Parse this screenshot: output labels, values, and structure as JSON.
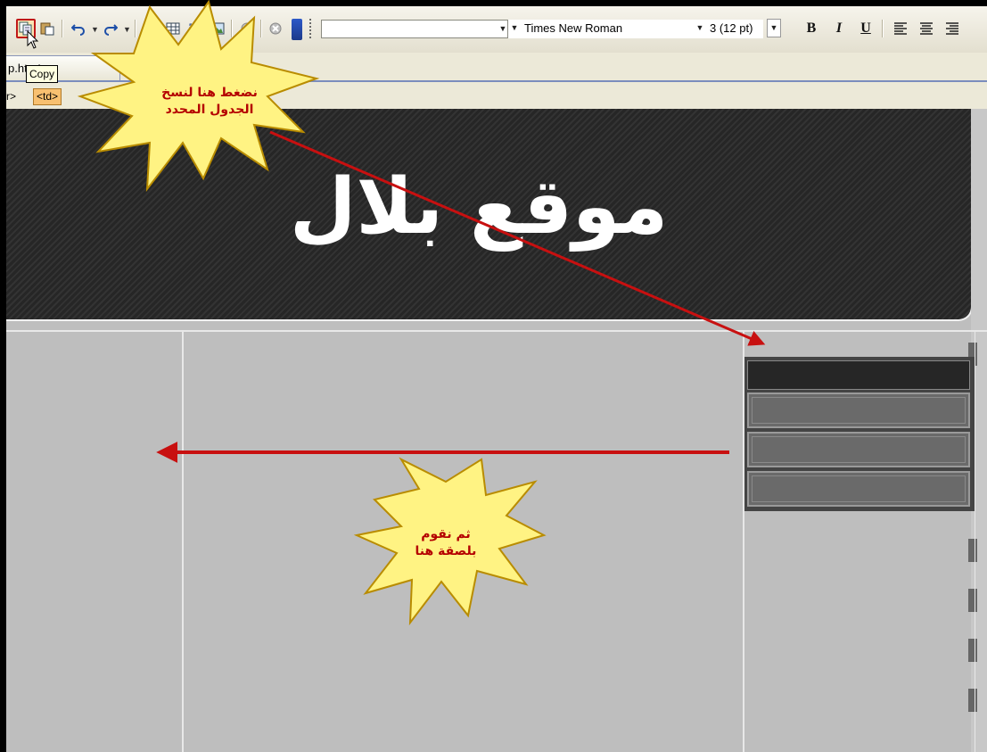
{
  "toolbar": {
    "buttons": [
      {
        "name": "copy-button",
        "icon": "copy-icon"
      },
      {
        "name": "paste-button",
        "icon": "paste-icon"
      },
      {
        "name": "undo-button",
        "icon": "undo-icon"
      },
      {
        "name": "redo-button",
        "icon": "redo-icon"
      },
      {
        "name": "insert-button",
        "icon": "insert-icon"
      },
      {
        "name": "table-button",
        "icon": "table-icon"
      },
      {
        "name": "layer-button",
        "icon": "layer-icon"
      },
      {
        "name": "image-button",
        "icon": "image-icon"
      },
      {
        "name": "link-button",
        "icon": "link-icon"
      },
      {
        "name": "stop-button",
        "icon": "stop-icon"
      }
    ],
    "style_value": "",
    "font_value": "Times New Roman",
    "size_value": "3 (12 pt)",
    "bold_label": "B",
    "italic_label": "I",
    "underline_label": "U",
    "align_icons": [
      "align-left-icon",
      "align-center-icon",
      "align-right-icon"
    ]
  },
  "tooltip": {
    "text": "Copy"
  },
  "tab": {
    "label": "p.htm*"
  },
  "tag_selector": {
    "tags": [
      "r>",
      "<td>"
    ]
  },
  "design": {
    "logo_text": "موقع بلال",
    "colors": {
      "banner": "#2b2b2b",
      "canvas": "#bebebe",
      "accent": "#c01818"
    }
  },
  "annotations": {
    "callout_1": {
      "line1": "نضغط هنا لنسخ",
      "line2": "الجدول المحدد"
    },
    "callout_2": {
      "line1": "ثم نقوم",
      "line2": "بلصقة هنا"
    }
  }
}
